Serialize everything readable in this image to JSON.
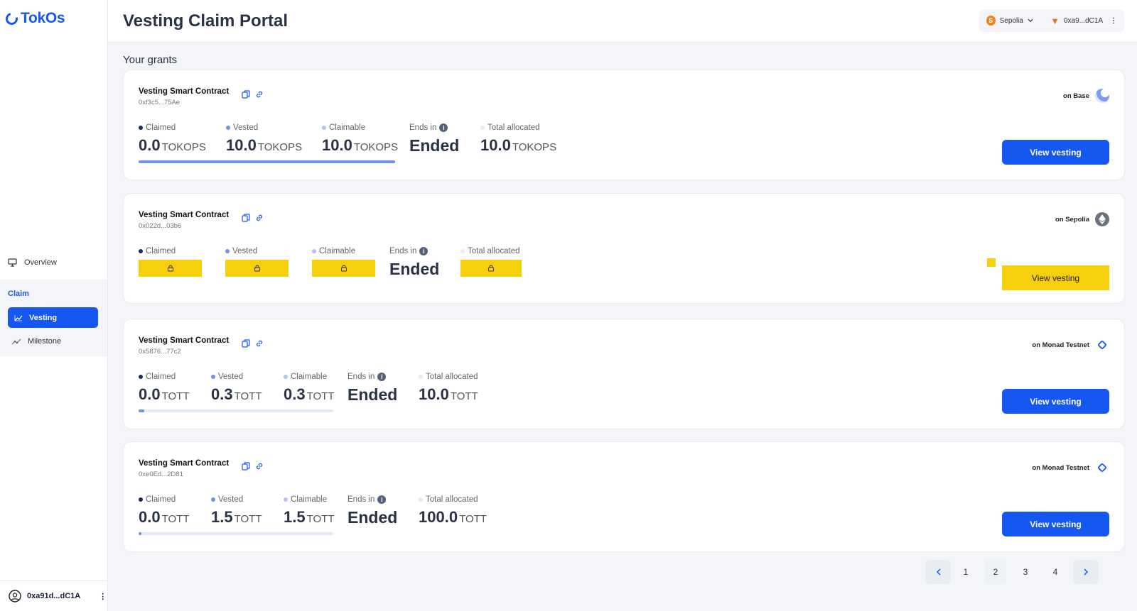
{
  "app": {
    "brand": "TokOs",
    "page_title": "Vesting Claim Portal"
  },
  "sidebar": {
    "overview": "Overview",
    "claim_group": "Claim",
    "vesting": "Vesting",
    "milestone": "Milestone",
    "account": "0xa91d...dC1A"
  },
  "header": {
    "network": "Sepolia",
    "wallet": "0xa9...dC1A"
  },
  "main": {
    "section_title": "Your grants"
  },
  "labels": {
    "contract": "Vesting Smart Contract",
    "claimed": "Claimed",
    "vested": "Vested",
    "claimable": "Claimable",
    "ends_in": "Ends in",
    "total": "Total allocated",
    "ended": "Ended",
    "view": "View vesting"
  },
  "grants": [
    {
      "address": "0xf3c5...75Ae",
      "chain": "on Base",
      "claimed": "0.0",
      "vested": "10.0",
      "claimable": "10.0",
      "total": "10.0",
      "unit": "TOKOPS",
      "progress": 1.0
    },
    {
      "address": "0x022d...03b6",
      "chain": "on Sepolia",
      "locked": true
    },
    {
      "address": "0x5876...77c2",
      "chain": "on Monad Testnet",
      "claimed": "0.0",
      "vested": "0.3",
      "claimable": "0.3",
      "total": "10.0",
      "unit": "TOTT",
      "progress": 0.03
    },
    {
      "address": "0xe0Ed...2D81",
      "chain": "on Monad Testnet",
      "claimed": "0.0",
      "vested": "1.5",
      "claimable": "1.5",
      "total": "100.0",
      "unit": "TOTT",
      "progress": 0.015
    }
  ],
  "pagination": {
    "pages": [
      "1",
      "2",
      "3",
      "4"
    ],
    "current": "2"
  },
  "colors": {
    "accent": "#1557f0",
    "locked": "#f6cf0d"
  }
}
